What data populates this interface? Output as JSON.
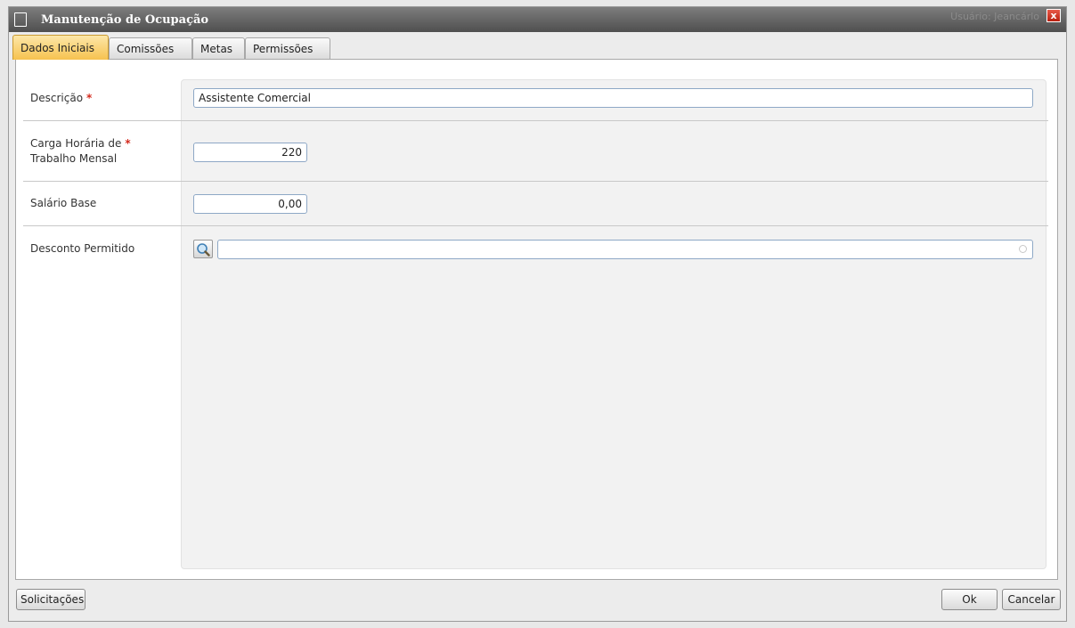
{
  "window": {
    "title": "Manutenção de Ocupação",
    "user_text": "Usuário:  Jeancárlo",
    "close_label": "x"
  },
  "tabs": [
    {
      "label": "Dados Iniciais",
      "active": true
    },
    {
      "label": "Comissões",
      "active": false
    },
    {
      "label": "Metas",
      "active": false
    },
    {
      "label": "Permissões",
      "active": false
    }
  ],
  "form": {
    "descricao": {
      "label": "Descrição",
      "required_mark": "*",
      "value": "Assistente Comercial"
    },
    "carga_horaria": {
      "label_line1": "Carga Horária de",
      "label_line2": "Trabalho Mensal",
      "required_mark": "*",
      "value": "220"
    },
    "salario_base": {
      "label": "Salário Base",
      "value": "0,00"
    },
    "desconto_permitido": {
      "label": "Desconto Permitido",
      "value": ""
    }
  },
  "footer": {
    "solicitacoes_label": "Solicitações",
    "ok_label": "Ok",
    "cancelar_label": "Cancelar"
  },
  "colors": {
    "accent_tab": "#f6c24f",
    "required": "#d42a1d",
    "input_border": "#8ea8c6"
  }
}
